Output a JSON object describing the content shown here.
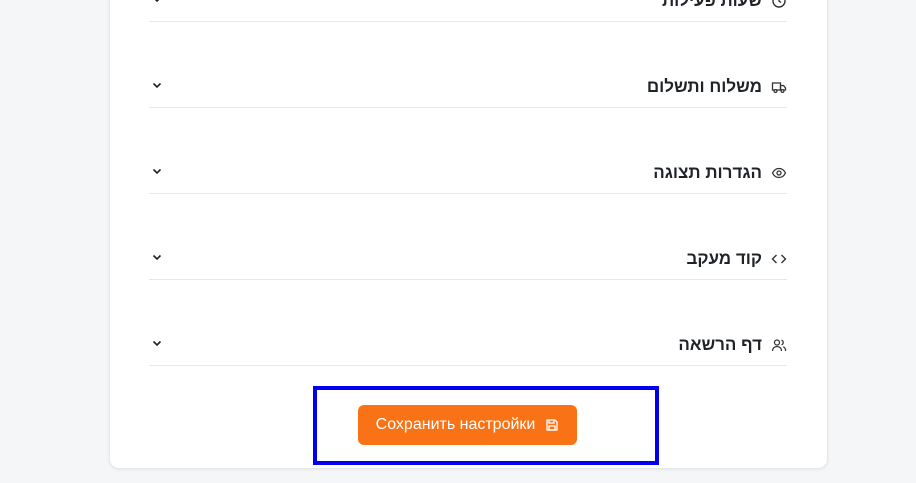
{
  "sections": [
    {
      "title": "שעות פעילות",
      "icon": "clock-icon"
    },
    {
      "title": "משלוח ותשלום",
      "icon": "truck-icon"
    },
    {
      "title": "הגדרות תצוגה",
      "icon": "eye-icon"
    },
    {
      "title": "קוד מעקב",
      "icon": "code-icon"
    },
    {
      "title": "דף הרשאה",
      "icon": "users-icon"
    }
  ],
  "save_button": {
    "label": "Сохранить настройки",
    "icon": "save-icon"
  },
  "colors": {
    "accent": "#f97316",
    "highlight_box": "#0000ee",
    "background": "#f5f6f8"
  }
}
